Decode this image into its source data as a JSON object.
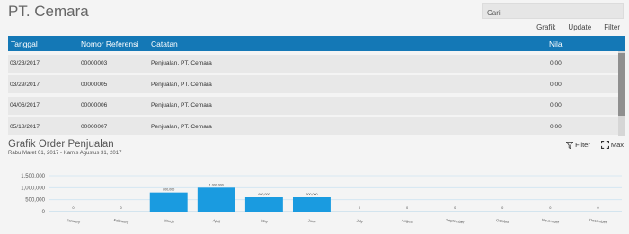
{
  "header": {
    "title": "PT. Cemara"
  },
  "search": {
    "placeholder": "Cari"
  },
  "toolbar": {
    "grafik": "Grafik",
    "update": "Update",
    "filter": "Filter"
  },
  "table": {
    "columns": [
      "Tanggal",
      "Nomor Referensi",
      "Catatan",
      "Nilai"
    ],
    "rows": [
      [
        "03/23/2017",
        "00000003",
        "Penjualan, PT. Cemara",
        "0,00"
      ],
      [
        "03/29/2017",
        "00000005",
        "Penjualan, PT. Cemara",
        "0,00"
      ],
      [
        "04/06/2017",
        "00000006",
        "Penjualan, PT. Cemara",
        "0,00"
      ],
      [
        "05/18/2017",
        "00000007",
        "Penjualan, PT. Cemara",
        "0,00"
      ]
    ]
  },
  "chart": {
    "title": "Grafik Order Penjualan",
    "subtitle": "Rabu Maret 01, 2017 - Kamis Agustus 31, 2017",
    "filter_label": "Filter",
    "max_label": "Max"
  },
  "chart_data": {
    "type": "bar",
    "categories": [
      "January",
      "February",
      "March",
      "April",
      "May",
      "June",
      "July",
      "August",
      "September",
      "October",
      "November",
      "December"
    ],
    "values": [
      0,
      0,
      800000,
      1000000,
      600000,
      600000,
      0,
      0,
      0,
      0,
      0,
      0
    ],
    "data_labels": [
      "0",
      "0",
      "800,000",
      "1,000,000",
      "600,000",
      "600,000",
      "0",
      "0",
      "0",
      "0",
      "0",
      "0"
    ],
    "yticks": [
      "0",
      "500,000",
      "1,000,000",
      "1,500,000"
    ],
    "ylim": [
      0,
      1500000
    ],
    "bar_color": "#1a9be0",
    "grid": true
  },
  "colors": {
    "header_bg": "#1478b6",
    "row_bg": "#e8e8e8",
    "accent": "#1a9be0"
  }
}
